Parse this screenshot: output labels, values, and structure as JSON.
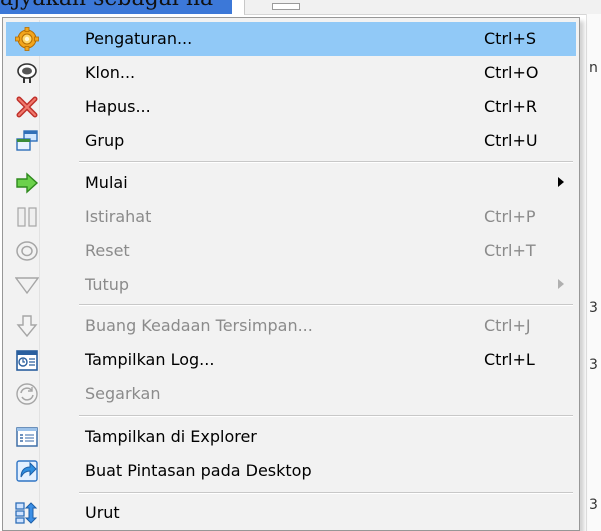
{
  "background": {
    "top_text": "ajyakan sebagai ha",
    "right_fragments": [
      "n",
      "3",
      "3",
      "3"
    ]
  },
  "menu": {
    "items": [
      {
        "label": "Pengaturan...",
        "shortcut": "Ctrl+S",
        "icon": "gear-icon",
        "enabled": true,
        "highlighted": true
      },
      {
        "label": "Klon...",
        "shortcut": "Ctrl+O",
        "icon": "clone-sheep-icon",
        "enabled": true
      },
      {
        "label": "Hapus...",
        "shortcut": "Ctrl+R",
        "icon": "delete-x-icon",
        "enabled": true
      },
      {
        "label": "Grup",
        "shortcut": "Ctrl+U",
        "icon": "group-windows-icon",
        "enabled": true
      },
      {
        "label": "Mulai",
        "shortcut": "",
        "icon": "start-arrow-icon",
        "enabled": true,
        "submenu": true
      },
      {
        "label": "Istirahat",
        "shortcut": "Ctrl+P",
        "icon": "pause-icon",
        "enabled": false
      },
      {
        "label": "Reset",
        "shortcut": "Ctrl+T",
        "icon": "reset-icon",
        "enabled": false
      },
      {
        "label": "Tutup",
        "shortcut": "",
        "icon": "close-triangle-icon",
        "enabled": false,
        "submenu": true
      },
      {
        "label": "Buang Keadaan Tersimpan...",
        "shortcut": "Ctrl+J",
        "icon": "discard-state-arrow-icon",
        "enabled": false
      },
      {
        "label": "Tampilkan Log...",
        "shortcut": "Ctrl+L",
        "icon": "log-icon",
        "enabled": true
      },
      {
        "label": "Segarkan",
        "shortcut": "",
        "icon": "refresh-icon",
        "enabled": false
      },
      {
        "label": "Tampilkan di Explorer",
        "shortcut": "",
        "icon": "explorer-list-icon",
        "enabled": true
      },
      {
        "label": "Buat Pintasan pada Desktop",
        "shortcut": "",
        "icon": "shortcut-arrow-icon",
        "enabled": true
      },
      {
        "label": "Urut",
        "shortcut": "",
        "icon": "sort-icon",
        "enabled": true
      }
    ]
  },
  "colors": {
    "highlight": "#91c9f7",
    "menu_bg": "#f2f2f2",
    "disabled_text": "#8b8b8b"
  }
}
